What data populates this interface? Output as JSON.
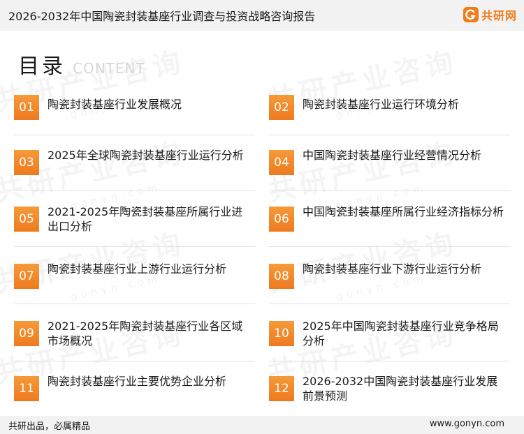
{
  "document": {
    "title": "2026-2032年中国陶瓷封装基座行业调查与投资战略咨询报告"
  },
  "logo": {
    "text": "共研网",
    "icon": "brand-logo-icon",
    "brand_color": "#f07d1c"
  },
  "watermark": {
    "text": "共研产业咨询",
    "url": "gonyn.com"
  },
  "toc": {
    "heading": "目录",
    "heading_en": "CONTENT",
    "accent_color": "#ef7a1f",
    "items": [
      {
        "num": "01",
        "label": "陶瓷封装基座行业发展概况"
      },
      {
        "num": "02",
        "label": "陶瓷封装基座行业运行环境分析"
      },
      {
        "num": "03",
        "label": "2025年全球陶瓷封装基座行业运行分析"
      },
      {
        "num": "04",
        "label": "中国陶瓷封装基座行业经营情况分析"
      },
      {
        "num": "05",
        "label": "2021-2025年陶瓷封装基座所属行业进出口分析"
      },
      {
        "num": "06",
        "label": "中国陶瓷封装基座所属行业经济指标分析"
      },
      {
        "num": "07",
        "label": "陶瓷封装基座行业上游行业运行分析"
      },
      {
        "num": "08",
        "label": "陶瓷封装基座行业下游行业运行分析"
      },
      {
        "num": "09",
        "label": "2021-2025年陶瓷封装基座行业各区域市场概况"
      },
      {
        "num": "10",
        "label": "2025年中国陶瓷封装基座行业竞争格局分析"
      },
      {
        "num": "11",
        "label": "陶瓷封装基座行业主要优势企业分析"
      },
      {
        "num": "12",
        "label": "2026-2032中国陶瓷封装基座行业发展前景预测"
      }
    ]
  },
  "footer": {
    "slogan": "共研出品，必属精品",
    "url": "www.gonyn.com"
  }
}
